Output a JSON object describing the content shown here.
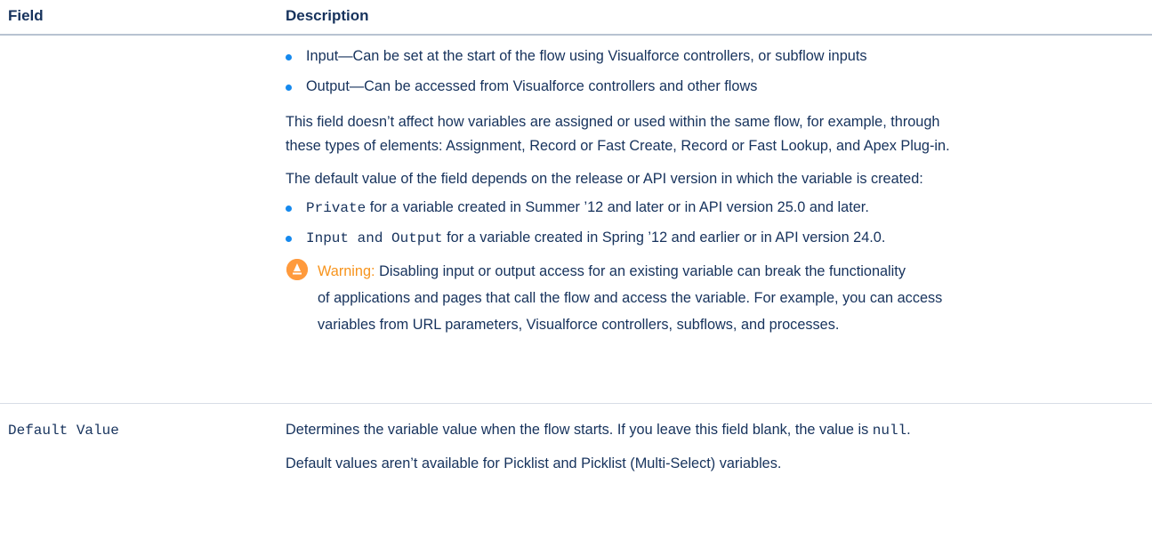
{
  "header": {
    "field_label": "Field",
    "description_label": "Description"
  },
  "row1": {
    "bullets_access": [
      "Input—Can be set at the start of the flow using Visualforce controllers, or subflow inputs",
      "Output—Can be accessed from Visualforce controllers and other flows"
    ],
    "para_affect_line1": "This field doesn’t affect how variables are assigned or used within the same flow, for example, through",
    "para_affect_line2": "these types of elements: Assignment, Record or Fast Create, Record or Fast Lookup, and Apex Plug-in.",
    "para_default": "The default value of the field depends on the release or API version in which the variable is created:",
    "bullet_private_code": "Private",
    "bullet_private_text": " for a variable created in Summer ’12 and later or in API version 25.0 and later.",
    "bullet_io_code": "Input and Output",
    "bullet_io_text": " for a variable created in Spring ’12 and earlier or in API version 24.0.",
    "warning_label": "Warning:",
    "warning_line1": " Disabling input or output access for an existing variable can break the functionality",
    "warning_line2": "of applications and pages that call the flow and access the variable. For example, you can access",
    "warning_line3": "variables from URL parameters, Visualforce controllers, subflows, and processes.",
    "warning_icon": "warning-icon",
    "warning_color": "#ff9a3c",
    "bullet_color": "#1589ee"
  },
  "row2": {
    "field_name": "Default Value",
    "desc_line1_prefix": "Determines the variable value when the flow starts. If you leave this field blank, the value is ",
    "desc_line1_code": "null",
    "desc_line1_suffix": ".",
    "desc_line2": "Default values aren’t available for Picklist and Picklist (Multi-Select) variables."
  }
}
